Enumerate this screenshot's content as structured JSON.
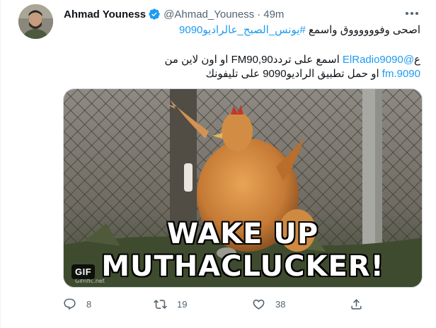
{
  "tweet": {
    "display_name": "Ahmad Youness",
    "handle": "@Ahmad_Youness",
    "separator": "·",
    "time": "49m",
    "line1_text": "اصحى وفووووووق واسمع ",
    "line1_hashtag": "#يونس_الصبح_عالراديو9090",
    "line2_prefix": "ع",
    "line2_mention": "@ElRadio9090",
    "line2_text": " اسمع على ترددFM90,90 او اون لاين من",
    "line3_link": "9090.fm",
    "line3_text": " او حمل تطبيق الراديو9090 على تليفونك"
  },
  "media": {
    "caption": "WAKE UP MUTHACLUCKER!",
    "badge": "GIF",
    "watermark": "Gifrific.net"
  },
  "actions": {
    "reply_count": "8",
    "retweet_count": "19",
    "like_count": "38"
  },
  "colors": {
    "link": "#1d9bf0",
    "verified": "#1d9bf0",
    "secondary_text": "#536471"
  },
  "icons": [
    "verified-badge-icon",
    "more-icon",
    "reply-icon",
    "retweet-icon",
    "like-icon",
    "share-icon"
  ]
}
